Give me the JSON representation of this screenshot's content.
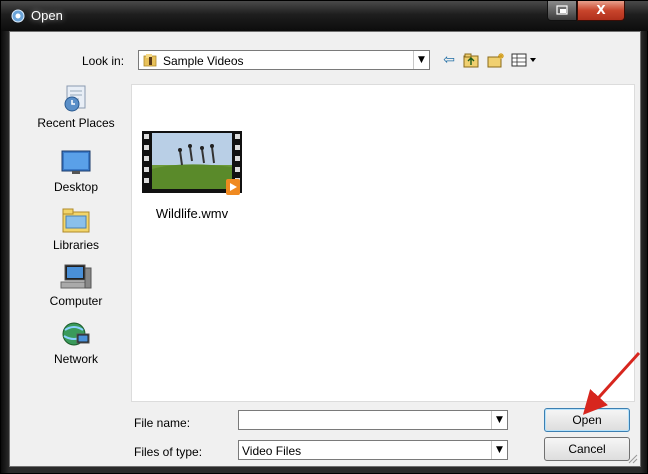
{
  "window": {
    "title": "Open",
    "close_glyph": "X"
  },
  "lookin": {
    "label": "Look in:",
    "value": "Sample Videos"
  },
  "toolbar": {
    "back_glyph": "⇦",
    "up_glyph": "⮤",
    "newfolder_glyph": "✦",
    "views_glyph": "▦▾"
  },
  "places": [
    {
      "label": "Recent Places",
      "icon": "recent-places-icon"
    },
    {
      "label": "Desktop",
      "icon": "desktop-icon"
    },
    {
      "label": "Libraries",
      "icon": "libraries-icon"
    },
    {
      "label": "Computer",
      "icon": "computer-icon"
    },
    {
      "label": "Network",
      "icon": "network-icon"
    }
  ],
  "files": [
    {
      "name": "Wildlife.wmv",
      "icon": "video-thumbnail-icon"
    }
  ],
  "filename": {
    "label": "File name:",
    "value": ""
  },
  "filetype": {
    "label": "Files of type:",
    "value": "Video Files"
  },
  "buttons": {
    "open": "Open",
    "cancel": "Cancel"
  },
  "colors": {
    "accent": "#3c7fb1",
    "arrow": "#d7261e",
    "close": "#c8452c"
  }
}
